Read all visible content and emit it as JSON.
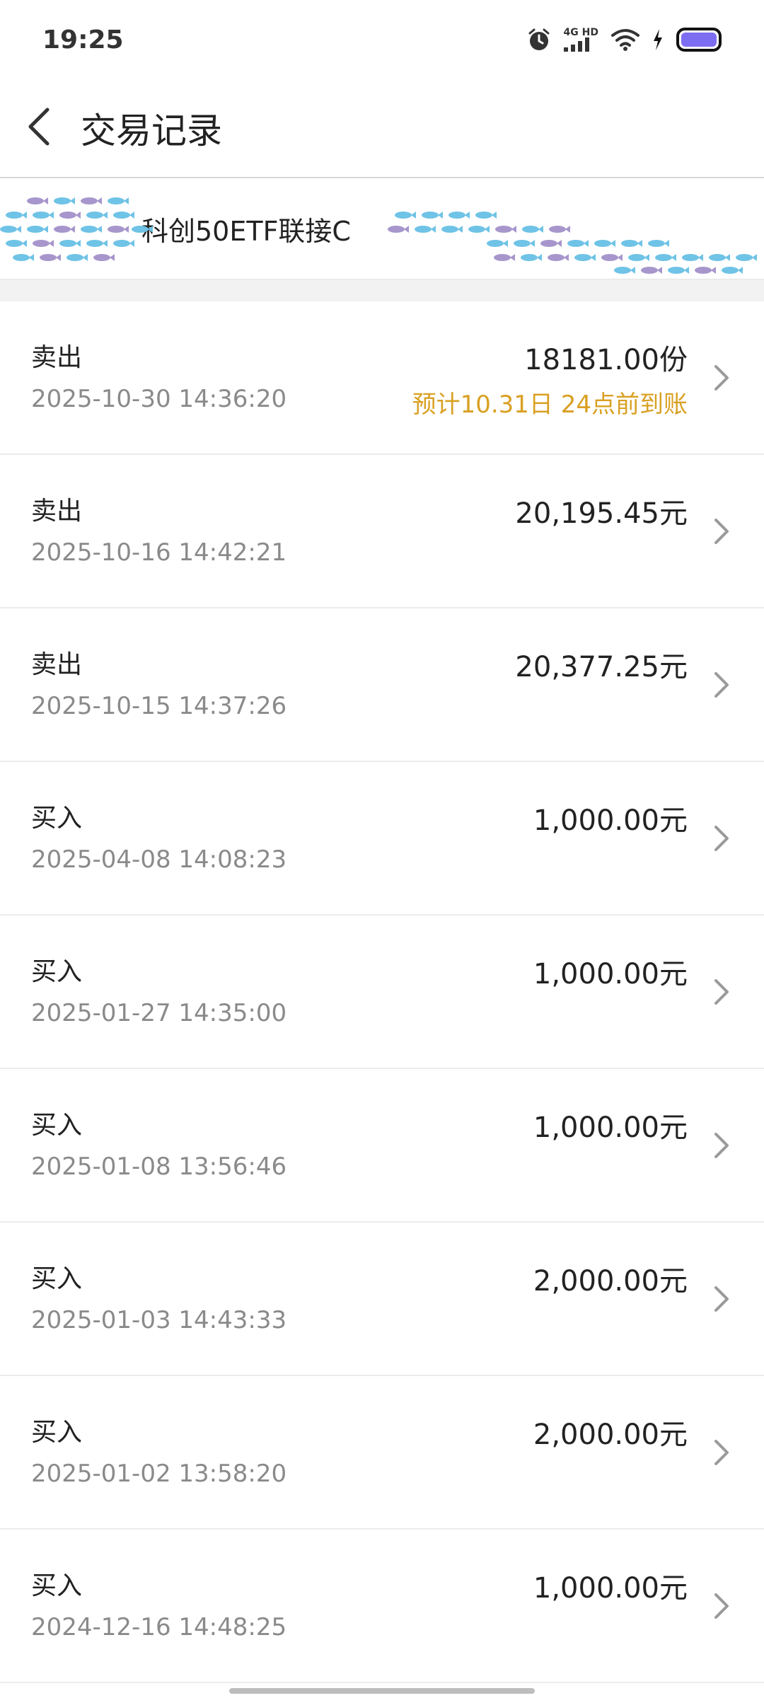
{
  "status_bar": {
    "time": "19:25",
    "network_label": "4G HD",
    "icons": [
      "alarm-icon",
      "signal-icon",
      "wifi-icon",
      "charging-icon",
      "battery-icon"
    ]
  },
  "header": {
    "title": "交易记录",
    "back_icon": "chevron-left-icon"
  },
  "fund": {
    "name": "科创50ETF联接C"
  },
  "colors": {
    "accent_note": "#d9a022",
    "battery": "#7d6df0"
  },
  "transactions": [
    {
      "type": "卖出",
      "time": "2025-10-30 14:36:20",
      "amount": "18181.00份",
      "note": "预计10.31日 24点前到账"
    },
    {
      "type": "卖出",
      "time": "2025-10-16 14:42:21",
      "amount": "20,195.45元",
      "note": ""
    },
    {
      "type": "卖出",
      "time": "2025-10-15 14:37:26",
      "amount": "20,377.25元",
      "note": ""
    },
    {
      "type": "买入",
      "time": "2025-04-08 14:08:23",
      "amount": "1,000.00元",
      "note": ""
    },
    {
      "type": "买入",
      "time": "2025-01-27 14:35:00",
      "amount": "1,000.00元",
      "note": ""
    },
    {
      "type": "买入",
      "time": "2025-01-08 13:56:46",
      "amount": "1,000.00元",
      "note": ""
    },
    {
      "type": "买入",
      "time": "2025-01-03 14:43:33",
      "amount": "2,000.00元",
      "note": ""
    },
    {
      "type": "买入",
      "time": "2025-01-02 13:58:20",
      "amount": "2,000.00元",
      "note": ""
    },
    {
      "type": "买入",
      "time": "2024-12-16 14:48:25",
      "amount": "1,000.00元",
      "note": ""
    }
  ]
}
